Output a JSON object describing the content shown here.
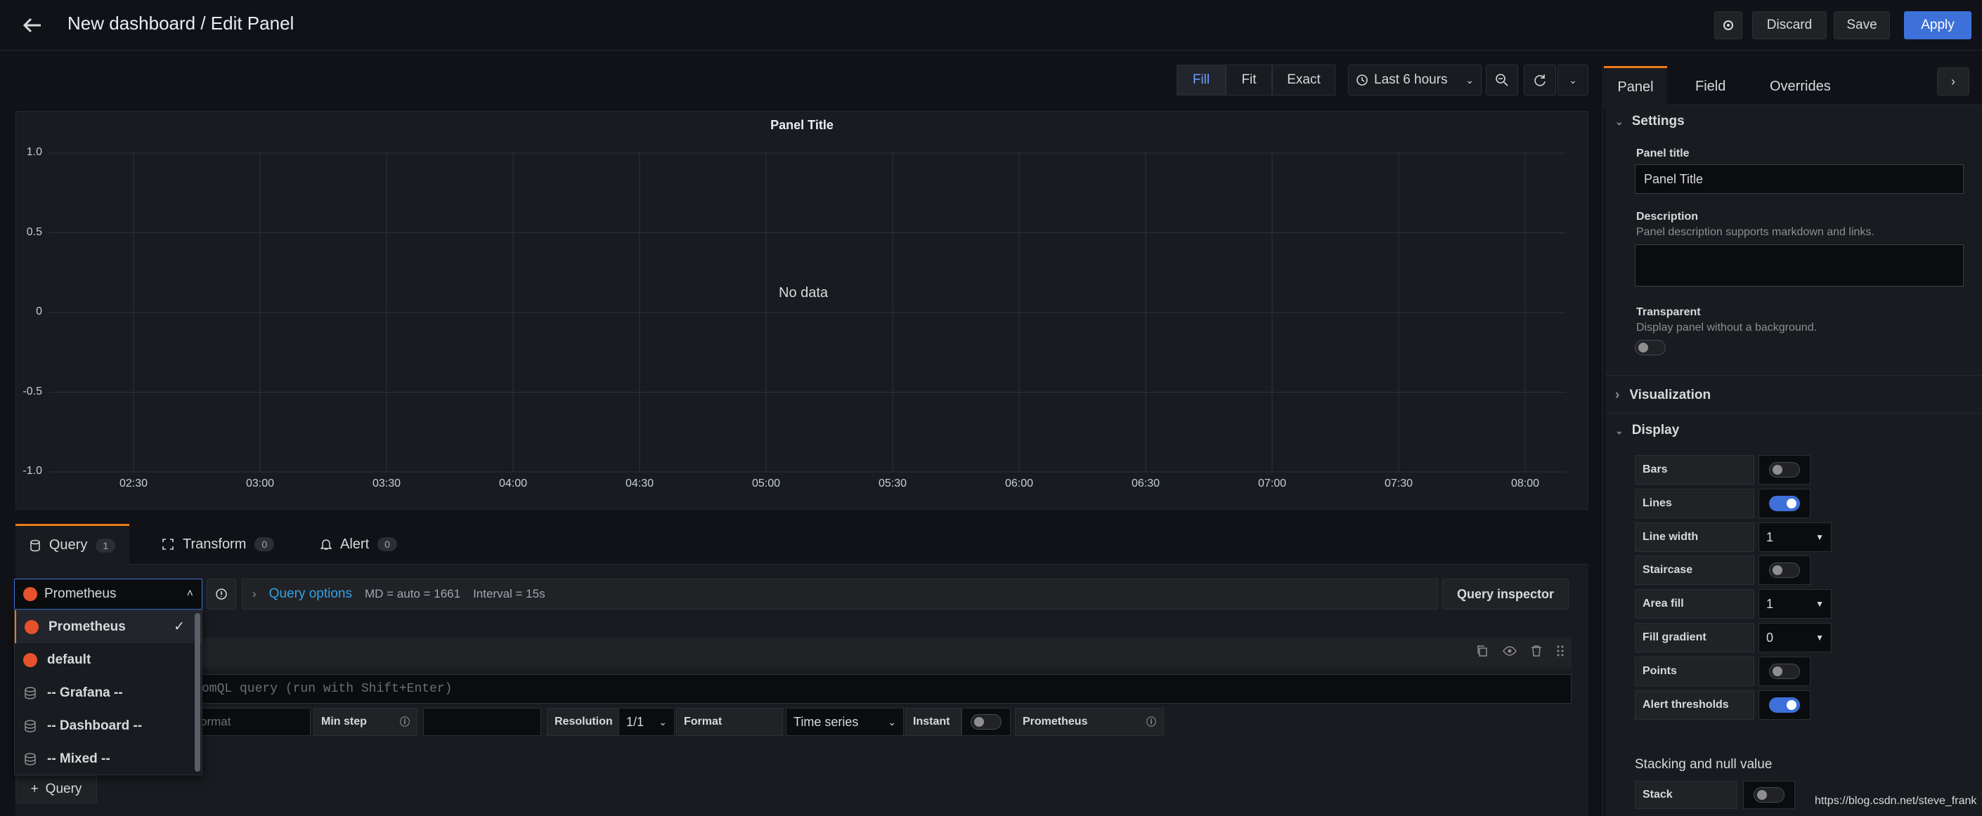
{
  "header": {
    "title": "New dashboard / Edit Panel",
    "discard_label": "Discard",
    "save_label": "Save",
    "apply_label": "Apply"
  },
  "toolbar": {
    "fill_label": "Fill",
    "fit_label": "Fit",
    "exact_label": "Exact",
    "time_range": "Last 6 hours"
  },
  "panel": {
    "title": "Panel Title",
    "no_data": "No data",
    "y_ticks": [
      "1.0",
      "0.5",
      "0",
      "-0.5",
      "-1.0"
    ],
    "x_ticks": [
      "02:30",
      "03:00",
      "03:30",
      "04:00",
      "04:30",
      "05:00",
      "05:30",
      "06:00",
      "06:30",
      "07:00",
      "07:30",
      "08:00"
    ]
  },
  "query_tabs": [
    {
      "label": "Query",
      "count": "1"
    },
    {
      "label": "Transform",
      "count": "0"
    },
    {
      "label": "Alert",
      "count": "0"
    }
  ],
  "query": {
    "datasource": "Prometheus",
    "query_options_label": "Query options",
    "md_text": "MD = auto = 1661",
    "interval_text": "Interval = 15s",
    "inspector_label": "Query inspector",
    "query_placeholder": "omQL query (run with Shift+Enter)",
    "legend_placeholder": "ormat",
    "min_step_label": "Min step",
    "resolution_label": "Resolution",
    "resolution_value": "1/1",
    "format_label": "Format",
    "format_value": "Time series",
    "instant_label": "Instant",
    "prometheus_label": "Prometheus",
    "add_query_label": "Query"
  },
  "datasource_dropdown": {
    "items": [
      "Prometheus",
      "default",
      "-- Grafana --",
      "-- Dashboard --",
      "-- Mixed --"
    ]
  },
  "options_tabs": [
    "Panel",
    "Field",
    "Overrides"
  ],
  "settings": {
    "section_label": "Settings",
    "panel_title_label": "Panel title",
    "panel_title_value": "Panel Title",
    "description_label": "Description",
    "description_help": "Panel description supports markdown and links.",
    "transparent_label": "Transparent",
    "transparent_help": "Display panel without a background."
  },
  "visualization_label": "Visualization",
  "display": {
    "section_label": "Display",
    "rows": [
      {
        "label": "Bars",
        "type": "toggle",
        "on": false
      },
      {
        "label": "Lines",
        "type": "toggle",
        "on": true
      },
      {
        "label": "Line width",
        "type": "select",
        "value": "1"
      },
      {
        "label": "Staircase",
        "type": "toggle",
        "on": false
      },
      {
        "label": "Area fill",
        "type": "select",
        "value": "1"
      },
      {
        "label": "Fill gradient",
        "type": "select",
        "value": "0"
      },
      {
        "label": "Points",
        "type": "toggle",
        "on": false
      },
      {
        "label": "Alert thresholds",
        "type": "toggle",
        "on": true
      }
    ]
  },
  "stacking": {
    "section_label": "Stacking and null value",
    "stack_label": "Stack"
  },
  "watermark": "https://blog.csdn.net/steve_frank"
}
